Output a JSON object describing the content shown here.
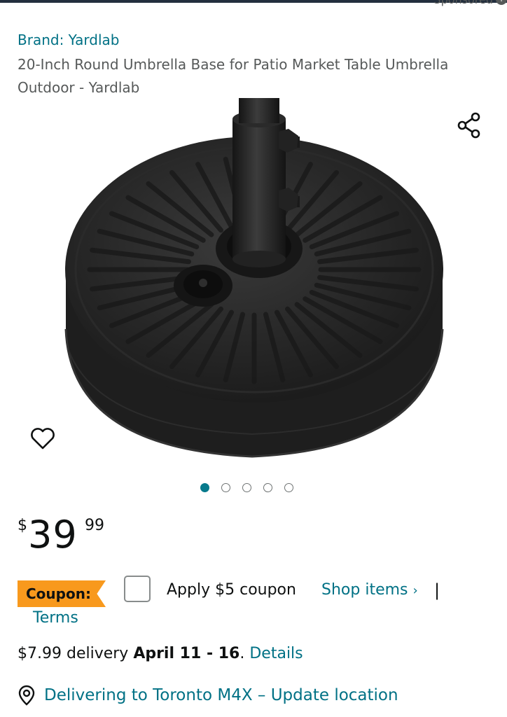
{
  "header": {
    "sponsored_label": "Sponsored"
  },
  "product": {
    "brand": "Brand: Yardlab",
    "title": "20-Inch Round Umbrella Base for Patio Market Table Umbrella Outdoor - Yardlab"
  },
  "gallery": {
    "total_images": 5,
    "active_index": 0
  },
  "price": {
    "currency": "$",
    "whole": "39",
    "fraction": "99"
  },
  "coupon": {
    "badge": "Coupon:",
    "apply_label": "Apply $5 coupon",
    "shop_items_label": "Shop items",
    "separator": "|",
    "terms_label": "Terms"
  },
  "delivery": {
    "prefix": "$7.99 delivery ",
    "dates": "April 11 - 16",
    "period": ".",
    "details_label": "Details"
  },
  "location": {
    "label": "Delivering to Toronto M4X – Update location"
  },
  "icons": {
    "share": "share-icon",
    "wishlist": "heart-icon",
    "location": "location-pin-icon",
    "chevron": "chevron-right-icon"
  },
  "colors": {
    "link": "#007185",
    "coupon_badge": "#f8991d",
    "active_dot": "#077a8c"
  }
}
